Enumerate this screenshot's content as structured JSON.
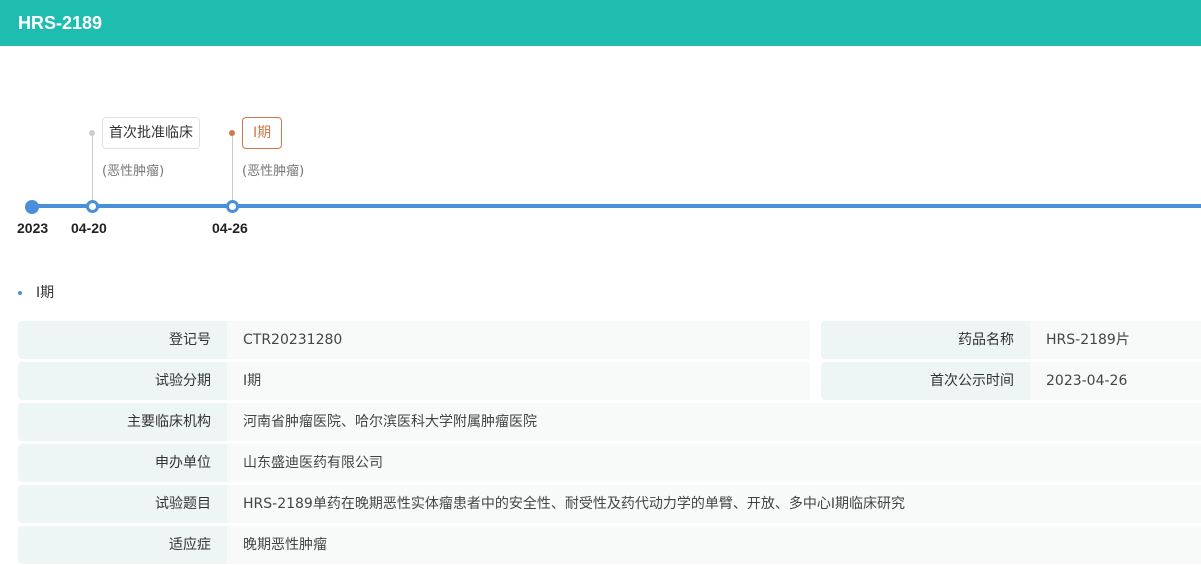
{
  "header": {
    "title": "HRS-2189"
  },
  "timeline": {
    "year": "2023",
    "events": [
      {
        "date": "04-20",
        "tag": "首次批准临床",
        "sub": "(恶性肿瘤)",
        "color": "#cccccc"
      },
      {
        "date": "04-26",
        "tag": "Ⅰ期",
        "sub": "(恶性肿瘤)",
        "color": "#d0784a"
      }
    ]
  },
  "section": {
    "title": "Ⅰ期"
  },
  "details": {
    "reg_label": "登记号",
    "reg_value": "CTR20231280",
    "drug_label": "药品名称",
    "drug_value": "HRS-2189片",
    "phase_label": "试验分期",
    "phase_value": "Ⅰ期",
    "pub_label": "首次公示时间",
    "pub_value": "2023-04-26",
    "inst_label": "主要临床机构",
    "inst_value": "河南省肿瘤医院、哈尔滨医科大学附属肿瘤医院",
    "sponsor_label": "申办单位",
    "sponsor_value": "山东盛迪医药有限公司",
    "title_label": "试验题目",
    "title_value": "HRS-2189单药在晚期恶性实体瘤患者中的安全性、耐受性及药代动力学的单臂、开放、多中心I期临床研究",
    "ind_label": "适应症",
    "ind_value": "晚期恶性肿瘤"
  }
}
